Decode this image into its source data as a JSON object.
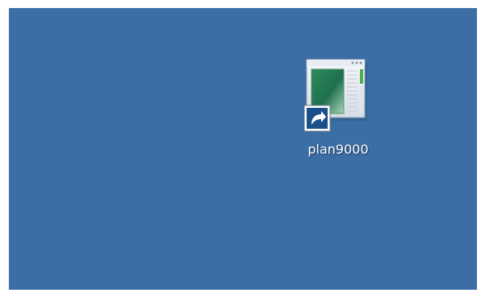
{
  "desktop": {
    "background_color": "#3a6ea5",
    "icons": [
      {
        "label": "plan9000",
        "icon": "application-window-icon",
        "overlay": "shortcut-arrow-icon"
      }
    ]
  }
}
